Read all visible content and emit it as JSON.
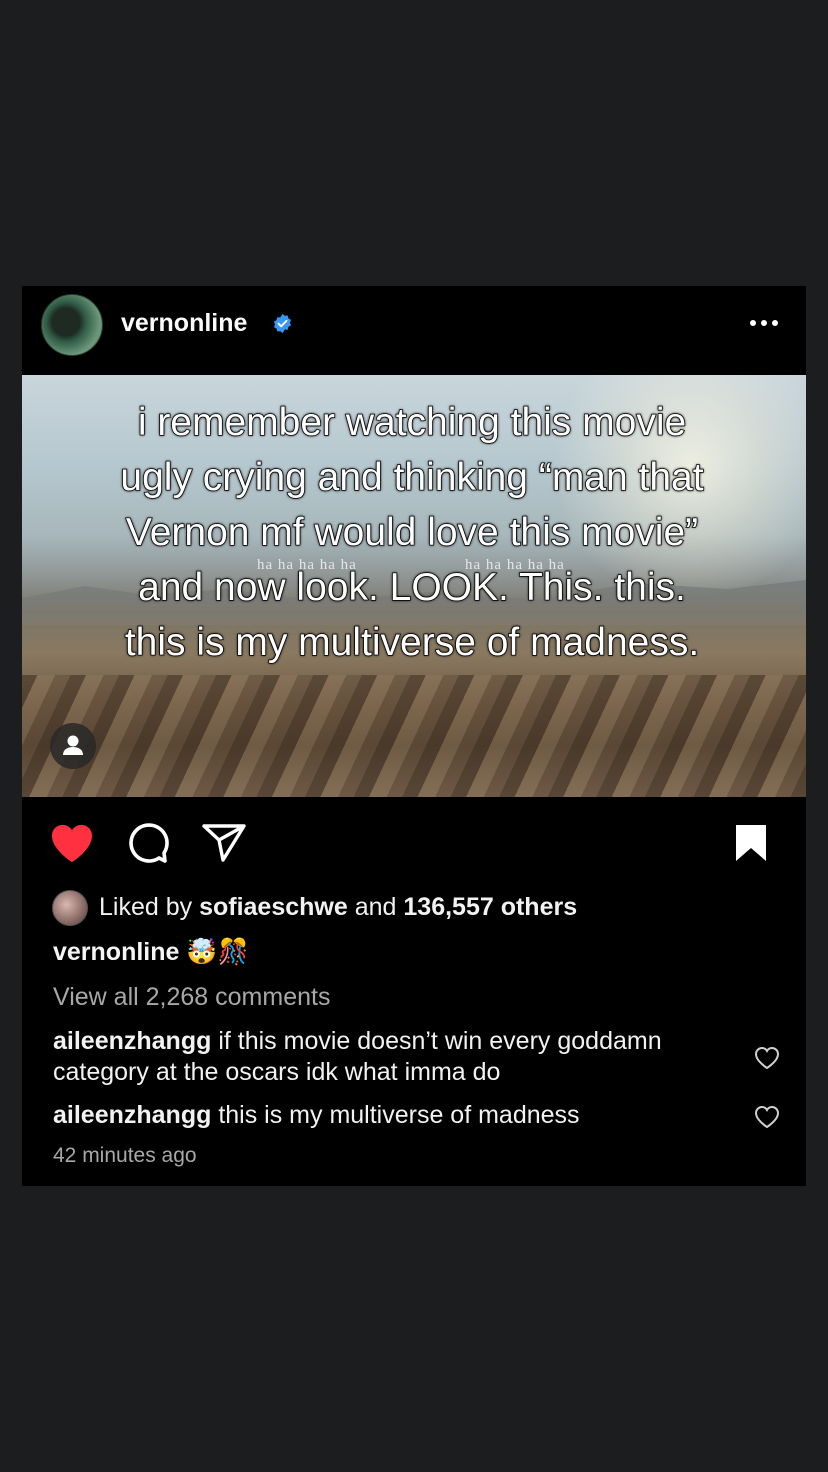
{
  "post": {
    "username": "vernonline",
    "overlay_text": "i remember watching this movie ugly crying and thinking “man that Vernon mf would love this movie” and now look. LOOK. This. this. this is my multiverse of madness.",
    "subtitles_left": "ha ha ha ha ha",
    "subtitles_right": "ha ha ha ha ha",
    "liked_prefix": "Liked by",
    "liked_user": "sofiaeschwe",
    "liked_and": "and",
    "liked_others": "136,557 others",
    "caption_user": "vernonline",
    "caption_emoji": "🤯🎊",
    "view_all": "View all 2,268 comments",
    "comments": [
      {
        "user": "aileenzhangg",
        "text": "if this movie doesn’t win every goddamn category at the oscars idk what imma do"
      },
      {
        "user": "aileenzhangg",
        "text": "this is my multiverse of madness"
      }
    ],
    "timestamp": "42 minutes ago"
  },
  "icons": {
    "verified": "verified-badge-icon",
    "more": "more-options-icon",
    "like": "heart-filled-icon",
    "comment": "comment-icon",
    "share": "send-icon",
    "save": "bookmark-filled-icon",
    "tag": "person-tag-icon"
  },
  "colors": {
    "background": "#1b1d1e",
    "post_bg": "#000000",
    "like_red": "#ff3040",
    "verified_blue": "#3897f0",
    "muted_text": "#a8a8a8"
  }
}
